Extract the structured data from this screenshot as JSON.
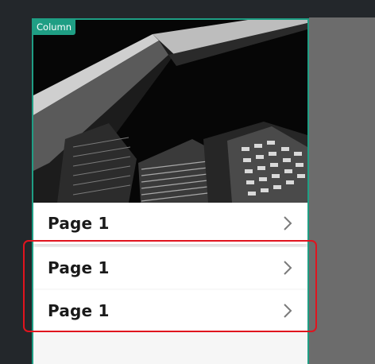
{
  "column": {
    "tag": "Column"
  },
  "hero": {
    "icon": "building-photo"
  },
  "menu": {
    "items": [
      {
        "label": "Page 1",
        "icon": "chevron-right-icon"
      },
      {
        "label": "Page 1",
        "icon": "chevron-right-icon"
      },
      {
        "label": "Page 1",
        "icon": "chevron-right-icon"
      }
    ]
  },
  "colors": {
    "accent": "#1f9e84",
    "selection": "#e0141e"
  }
}
